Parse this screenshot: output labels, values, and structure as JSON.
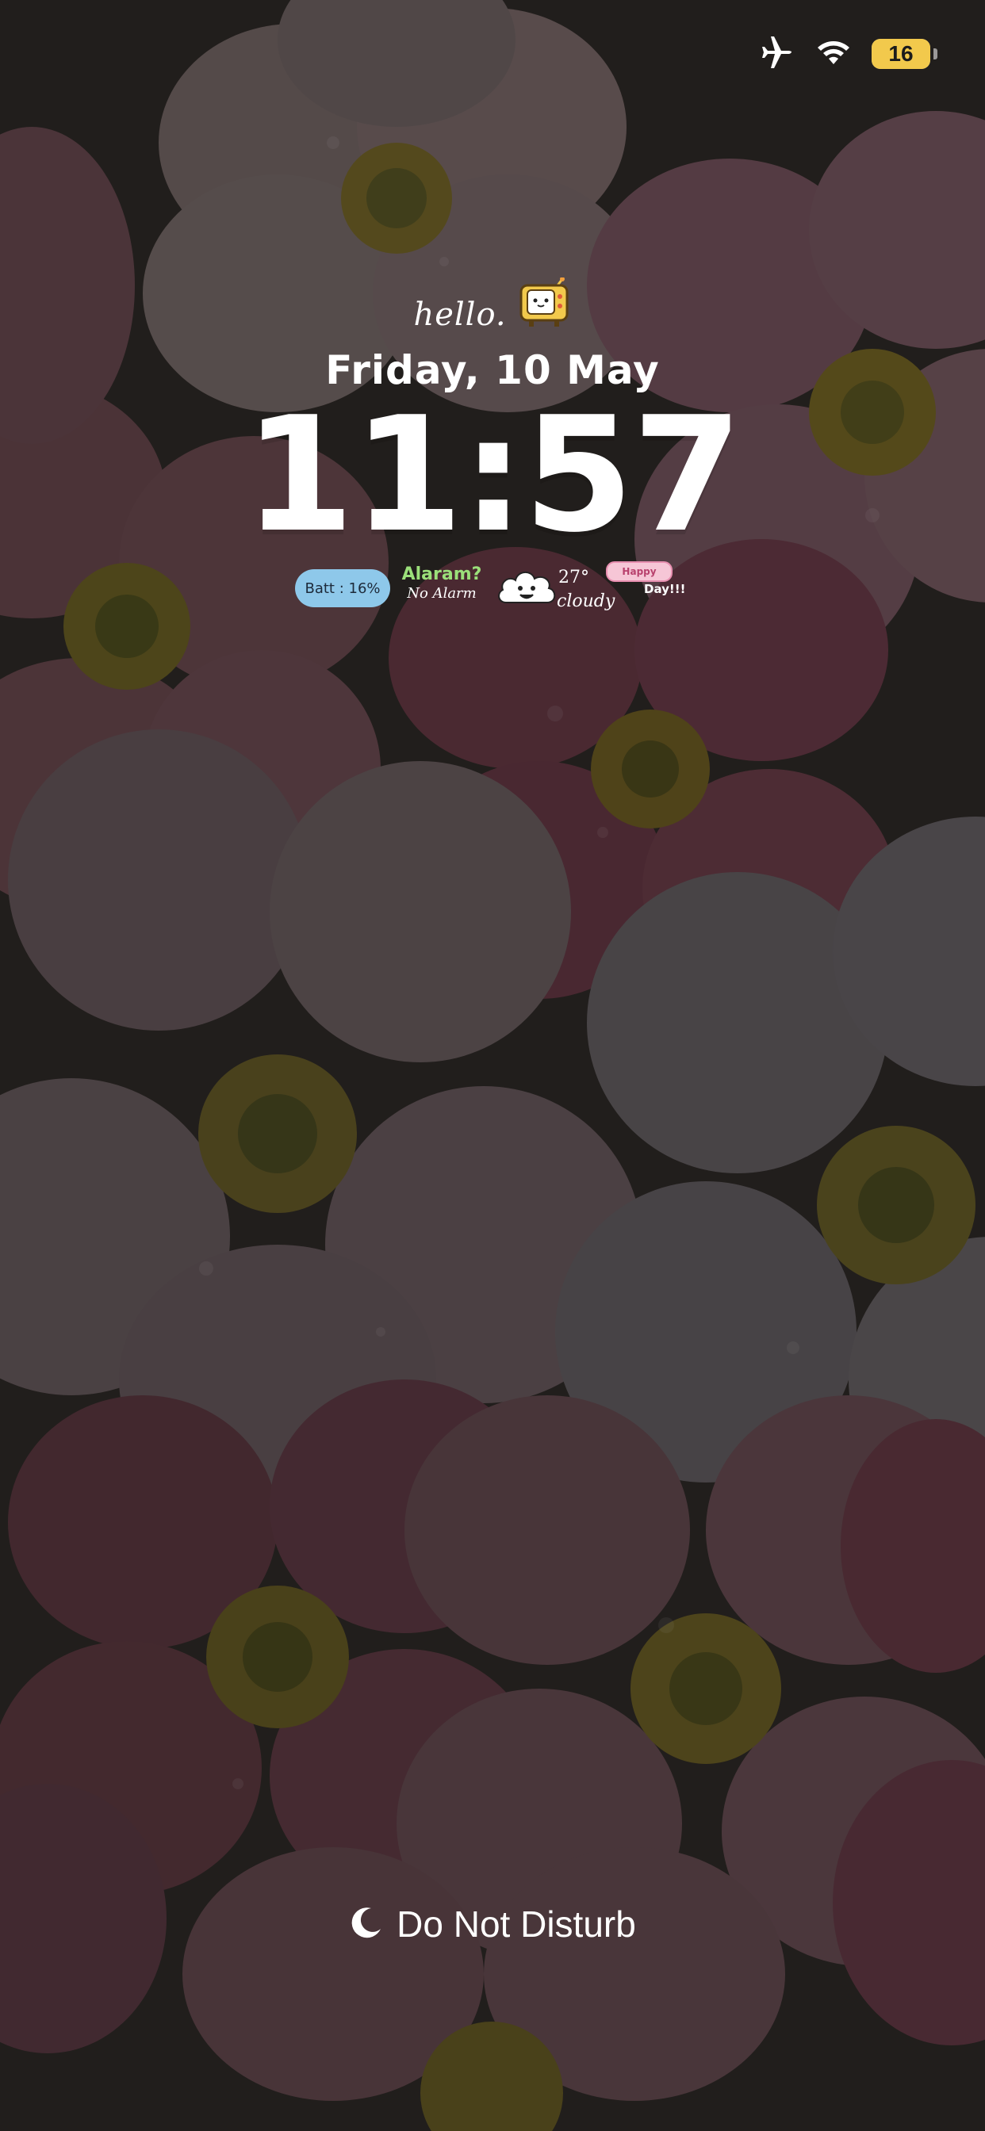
{
  "status_bar": {
    "battery_percent": "16",
    "battery_level": 0.16,
    "icons": [
      "airplane-icon",
      "wifi-icon",
      "battery-icon"
    ]
  },
  "lock_screen": {
    "greeting": "hello.",
    "date": "Friday, 10 May",
    "time": "11:57"
  },
  "widgets": {
    "battery": "Batt : 16%",
    "alarm_title": "Alaram?",
    "alarm_status": "No Alarm",
    "temperature": "27°",
    "condition": "cloudy",
    "day_top": "Happy",
    "day_bottom": "Day!!!"
  },
  "focus": {
    "label": "Do Not Disturb",
    "icon": "moon-icon"
  },
  "colors": {
    "accent_green": "#9be07a",
    "battery_widget_blue": "#8ec8ea",
    "battery_yellow": "#f2c94c"
  }
}
